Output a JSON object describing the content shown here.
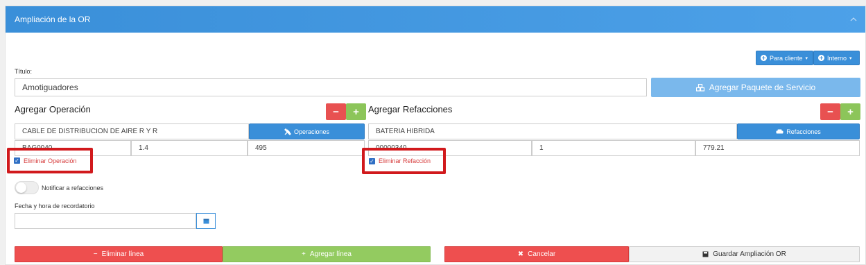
{
  "header": {
    "title": "Ampliación de la OR",
    "collapse_icon": "chevron-up-icon"
  },
  "toolbar": {
    "para_cliente_label": "Para cliente",
    "interno_label": "Interno"
  },
  "form": {
    "titulo_label": "Título:",
    "titulo_value": "Amotiguadores",
    "paquete_button": "Agregar Paquete de Servicio",
    "notify_label": "Notificar a refacciones",
    "reminder_label": "Fecha y hora de recordatorio",
    "reminder_value": ""
  },
  "operacion": {
    "title": "Agregar Operación",
    "name_value": "CABLE DE DISTRIBUCION DE AIRE R Y R",
    "code_value": "BAG0040",
    "qty_value": "1.4",
    "price_value": "495",
    "search_button": "Operaciones",
    "delete_label": "Eliminar Operación",
    "delete_checked": true
  },
  "refacciones": {
    "title": "Agregar Refacciones",
    "name_value": "BATERIA HIBRIDA",
    "code_value": "00000340",
    "qty_value": "1",
    "price_value": "779.21",
    "search_button": "Refacciones",
    "delete_label": "Eliminar Refacción",
    "delete_checked": true
  },
  "actions": {
    "minus_label": "−",
    "plus_label": "+",
    "eliminar_linea": "Eliminar línea",
    "agregar_linea": "Agregar línea",
    "cancelar": "Cancelar",
    "guardar": "Guardar Ampliación OR"
  },
  "colors": {
    "primary": "#3a8fd9",
    "danger": "#ee4f4f",
    "success": "#93cb60",
    "highlight": "#d1191c"
  }
}
